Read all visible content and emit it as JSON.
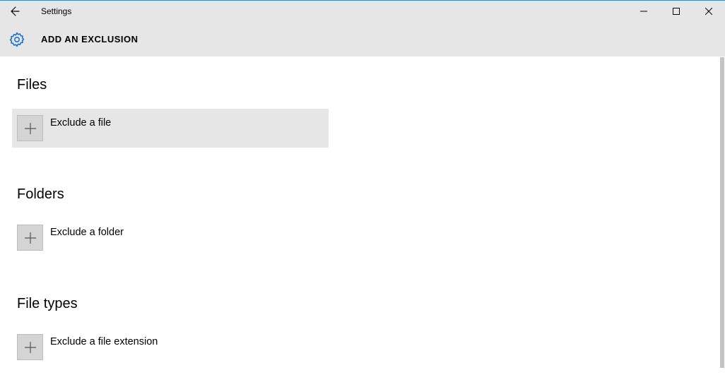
{
  "window": {
    "app_title": "Settings",
    "page_title": "ADD AN EXCLUSION"
  },
  "sections": {
    "files": {
      "heading": "Files",
      "action_label": "Exclude a file"
    },
    "folders": {
      "heading": "Folders",
      "action_label": "Exclude a folder"
    },
    "filetypes": {
      "heading": "File types",
      "action_label": "Exclude a file extension"
    }
  }
}
